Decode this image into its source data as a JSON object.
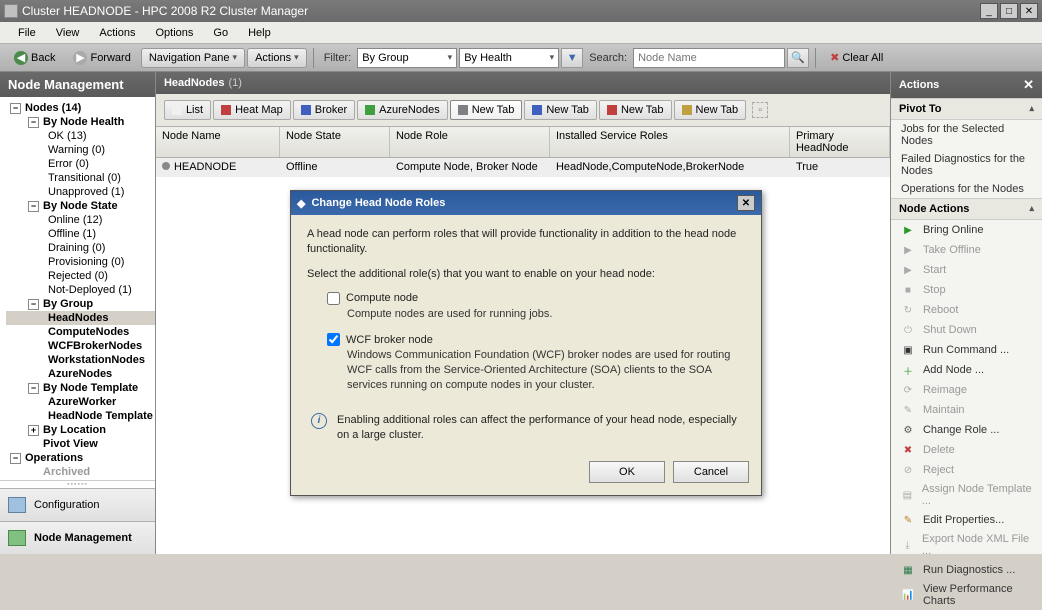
{
  "window": {
    "title": "Cluster HEADNODE - HPC 2008 R2 Cluster Manager"
  },
  "menu": [
    "File",
    "View",
    "Actions",
    "Options",
    "Go",
    "Help"
  ],
  "toolbar": {
    "back": "Back",
    "forward": "Forward",
    "navpane": "Navigation Pane",
    "actions": "Actions",
    "filter_label": "Filter:",
    "filter1": "By Group",
    "filter2": "By Health",
    "search_label": "Search:",
    "search_ph": "Node Name",
    "clear": "Clear All"
  },
  "left": {
    "header": "Node Management",
    "nodes_root": "Nodes (14)",
    "groups": {
      "health": {
        "label": "By Node Health",
        "items": [
          "OK (13)",
          "Warning (0)",
          "Error (0)",
          "Transitional (0)",
          "Unapproved (1)"
        ]
      },
      "state": {
        "label": "By Node State",
        "items": [
          "Online (12)",
          "Offline (1)",
          "Draining (0)",
          "Provisioning (0)",
          "Rejected (0)",
          "Not-Deployed (1)"
        ]
      },
      "group": {
        "label": "By Group",
        "items": [
          "HeadNodes",
          "ComputeNodes",
          "WCFBrokerNodes",
          "WorkstationNodes",
          "AzureNodes"
        ]
      },
      "template": {
        "label": "By Node Template",
        "items": [
          "AzureWorker",
          "HeadNode Template"
        ]
      },
      "location": {
        "label": "By Location"
      },
      "pivot": {
        "label": "Pivot View"
      }
    },
    "operations": "Operations",
    "archived": "Archived",
    "nav": {
      "config": "Configuration",
      "nodemgmt": "Node Management"
    }
  },
  "center": {
    "header": "HeadNodes",
    "count": "(1)",
    "tabs": [
      "List",
      "Heat Map",
      "Broker",
      "AzureNodes",
      "New Tab",
      "New Tab",
      "New Tab",
      "New Tab"
    ],
    "tabcolors": [
      "#f0f0f0",
      "#c04040",
      "#4060c0",
      "#40a040",
      "#808080",
      "#4060c0",
      "#c04040",
      "#c0a040"
    ],
    "cols": [
      "Node Name",
      "Node State",
      "Node Role",
      "Installed Service Roles",
      "Primary HeadNode"
    ],
    "row": {
      "name": "HEADNODE",
      "state": "Offline",
      "role": "Compute Node, Broker Node",
      "svc": "HeadNode,ComputeNode,BrokerNode",
      "primary": "True"
    }
  },
  "right": {
    "header": "Actions",
    "pivot_hdr": "Pivot To",
    "pivot_items": [
      "Jobs for the Selected Nodes",
      "Failed Diagnostics for the Nodes",
      "Operations for the Nodes"
    ],
    "nodeact_hdr": "Node Actions",
    "actions": [
      {
        "l": "Bring Online",
        "i": "▶",
        "c": "#2a9a2a",
        "d": false
      },
      {
        "l": "Take Offline",
        "i": "▶",
        "c": "#aaa",
        "d": true
      },
      {
        "l": "Start",
        "i": "▶",
        "c": "#aaa",
        "d": true
      },
      {
        "l": "Stop",
        "i": "■",
        "c": "#aaa",
        "d": true
      },
      {
        "l": "Reboot",
        "i": "↻",
        "c": "#aaa",
        "d": true
      },
      {
        "l": "Shut Down",
        "i": "⏻",
        "c": "#aaa",
        "d": true
      },
      {
        "l": "Run Command ...",
        "i": "▣",
        "c": "#333",
        "d": false
      },
      {
        "l": "Add Node ...",
        "i": "＋",
        "c": "#2a9a2a",
        "d": false
      },
      {
        "l": "Reimage",
        "i": "⟳",
        "c": "#aaa",
        "d": true
      },
      {
        "l": "Maintain",
        "i": "✎",
        "c": "#aaa",
        "d": true
      },
      {
        "l": "Change Role ...",
        "i": "⚙",
        "c": "#555",
        "d": false
      },
      {
        "l": "Delete",
        "i": "✖",
        "c": "#c04040",
        "d": true
      },
      {
        "l": "Reject",
        "i": "⊘",
        "c": "#aaa",
        "d": true
      },
      {
        "l": "Assign Node Template ...",
        "i": "▤",
        "c": "#aaa",
        "d": true
      },
      {
        "l": "Edit Properties...",
        "i": "✎",
        "c": "#c08030",
        "d": false
      },
      {
        "l": "Export Node XML File ...",
        "i": "⤓",
        "c": "#aaa",
        "d": true
      },
      {
        "l": "Run Diagnostics ...",
        "i": "▦",
        "c": "#2a7a4a",
        "d": false
      },
      {
        "l": "View Performance Charts",
        "i": "📊",
        "c": "#555",
        "d": false
      }
    ]
  },
  "dialog": {
    "title": "Change Head Node Roles",
    "p1": "A head node can perform roles that will provide functionality in addition to the head node functionality.",
    "p2": "Select the additional role(s) that you want to enable on your head node:",
    "opt1": "Compute node",
    "opt1_desc": "Compute nodes are used for running jobs.",
    "opt2": "WCF broker node",
    "opt2_desc": "Windows Communication Foundation (WCF) broker nodes are used for routing WCF calls from the Service-Oriented Architecture (SOA) clients to the SOA services running on compute nodes in your cluster.",
    "info": "Enabling additional roles can affect the performance of your head node, especially on a large cluster.",
    "ok": "OK",
    "cancel": "Cancel"
  }
}
